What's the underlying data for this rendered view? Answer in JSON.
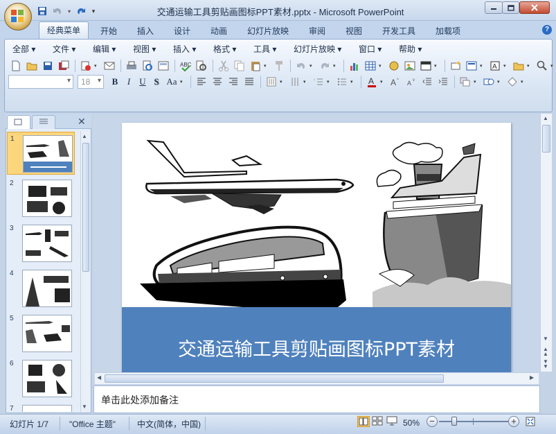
{
  "window": {
    "title": "交通运输工具剪贴画图标PPT素材.pptx - Microsoft PowerPoint",
    "qat_icons": [
      "save-icon",
      "undo-icon",
      "redo-icon",
      "customize-icon"
    ]
  },
  "ribbon_tabs": [
    "经典菜单",
    "开始",
    "插入",
    "设计",
    "动画",
    "幻灯片放映",
    "审阅",
    "视图",
    "开发工具",
    "加载项"
  ],
  "classic_menu": [
    "全部",
    "文件",
    "编辑",
    "视图",
    "插入",
    "格式",
    "工具",
    "幻灯片放映",
    "窗口",
    "帮助"
  ],
  "toolbar": {
    "font_name": "",
    "font_size": "18",
    "format_buttons": [
      "B",
      "I",
      "U",
      "S",
      "Aa"
    ]
  },
  "slides_pane": {
    "slide_numbers": [
      "1",
      "2",
      "3",
      "4",
      "5",
      "6",
      "7"
    ],
    "selected": "1"
  },
  "slide": {
    "title": "交通运输工具剪贴画图标PPT素材"
  },
  "notes": {
    "placeholder": "单击此处添加备注"
  },
  "status": {
    "slide_info": "幻灯片 1/7",
    "theme": "\"Office 主题\"",
    "language": "中文(简体，中国)",
    "zoom": "50%",
    "zoom_fraction": 0.5
  },
  "colors": {
    "slide_band": "#4f81bd",
    "ribbon": "#dce7f5",
    "selected_thumb": "#fbd67c"
  }
}
